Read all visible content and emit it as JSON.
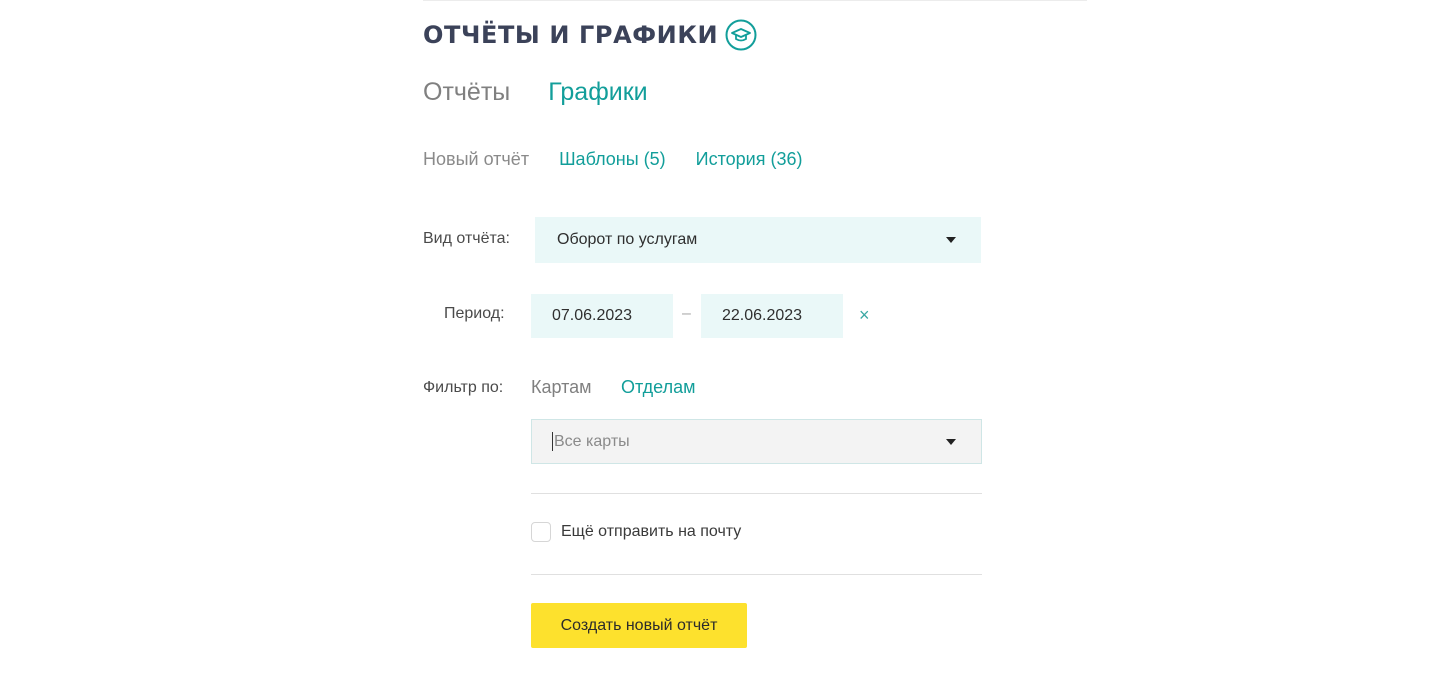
{
  "header": {
    "title": "ОТЧЁТЫ И ГРАФИКИ",
    "help_icon": "graduation-cap-icon"
  },
  "main_tabs": [
    {
      "label": "Отчёты",
      "active": false
    },
    {
      "label": "Графики",
      "active": true
    }
  ],
  "sub_tabs": [
    {
      "label": "Новый отчёт",
      "active": false
    },
    {
      "label": "Шаблоны (5)",
      "active": true
    },
    {
      "label": "История (36)",
      "active": true
    }
  ],
  "form": {
    "report_type": {
      "label": "Вид отчёта:",
      "value": "Оборот по услугам"
    },
    "period": {
      "label": "Период:",
      "from": "07.06.2023",
      "separator": "–",
      "to": "22.06.2023",
      "clear_symbol": "×"
    },
    "filter": {
      "label": "Фильтр по:",
      "options": [
        {
          "label": "Картам",
          "active": false
        },
        {
          "label": "Отделам",
          "active": true
        }
      ],
      "select_placeholder": "Все карты"
    },
    "email": {
      "label": "Ещё отправить на почту",
      "checked": false
    },
    "submit_label": "Создать новый отчёт"
  },
  "colors": {
    "accent": "#129e9a",
    "title": "#3b4259",
    "field_bg": "#eaf8f8",
    "button_bg": "#fde12d"
  }
}
